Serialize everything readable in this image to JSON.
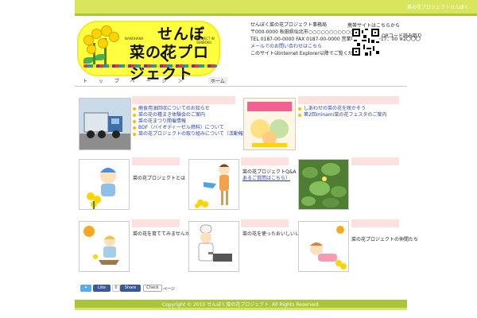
{
  "topbar": {
    "text": "菜の花プロジェクトせんぼく"
  },
  "logo": {
    "line1": "せんぼく",
    "line2": "菜の花プロジェクト",
    "small_left": "NANOHANA",
    "small_right": "PROJECT IN SENBOKU"
  },
  "info": {
    "lines": [
      "せんぼく菜の花プロジェクト事務局",
      "〒000-0000 秋田県仙北市○○○○○○○○○○○○○",
      "TEL 0187-00-0000 FAX 0187-00-0000 営業時間 9：00〜17：00 ※2〇〇〇",
      "メールでのお問い合わせはこちら",
      "このサイトはInternet Explorer以降でご覧ください（推奨）"
    ]
  },
  "qr": {
    "label": "携帯サイトはこちらから",
    "side": "QRコード読み取り"
  },
  "nav": {
    "items": "ト ッ プ ペ ー ジ ＞",
    "current": "ホーム"
  },
  "panels": {
    "top_left": {
      "items": [
        "廃食用油回収についてのお知らせ",
        "菜の花の種まき体験会のご案内",
        "菜の花まつり開催情報",
        "BDF（バイオディーゼル燃料）について",
        "菜の花プロジェクトの取り組みについて（活動報告書をご覧ください）"
      ]
    },
    "top_right": {
      "items": [
        "しあわせの菜の花を咲かそう",
        "第2回minami菜の花フェスタのご案内"
      ]
    },
    "mid": [
      {
        "text": "菜の花プロジェクトとは"
      },
      {
        "text": "菜の花プロジェクトQ&A（よく",
        "link": "あるご質問はこちら）"
      },
      {
        "text": ""
      }
    ],
    "bot": [
      {
        "text": "菜の花を育ててみませんか"
      },
      {
        "text": "菜の花を使ったおいしいレシピ"
      },
      {
        "text": "菜の花プロジェクトの仲間たち"
      }
    ]
  },
  "social": {
    "tweet": "Tweet",
    "like": "Like",
    "share": "Share",
    "check": "Check",
    "count": "0",
    "page_top": "ページ"
  },
  "footer": {
    "copyright": "Copyright © 2010 せんぼく菜の花プロジェクト. All Rights Reserved."
  },
  "colors": {
    "lime": "#d7e65d",
    "green": "#a9c63b",
    "pink": "#fde0e0",
    "link": "#2a3fa8",
    "flower": "#ffd400"
  }
}
